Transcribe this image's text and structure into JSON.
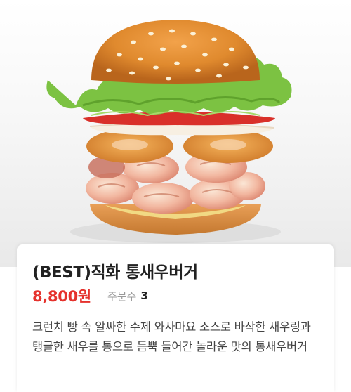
{
  "product": {
    "image_icon": "shrimp-burger-image",
    "name": "(BEST)직화 통새우버거",
    "price": "8,800원",
    "orders_label": "주문수",
    "orders_count": "3",
    "description": "크런치 빵 속 알싸한 수제 와사마요 소스로 바삭한 새우링과 탱글한 새우를 통으로 듬뿍 들어간 놀라운 맛의 통새우버거"
  },
  "colors": {
    "price": "#e5322d",
    "title": "#222222",
    "muted": "#9a9a9a"
  }
}
